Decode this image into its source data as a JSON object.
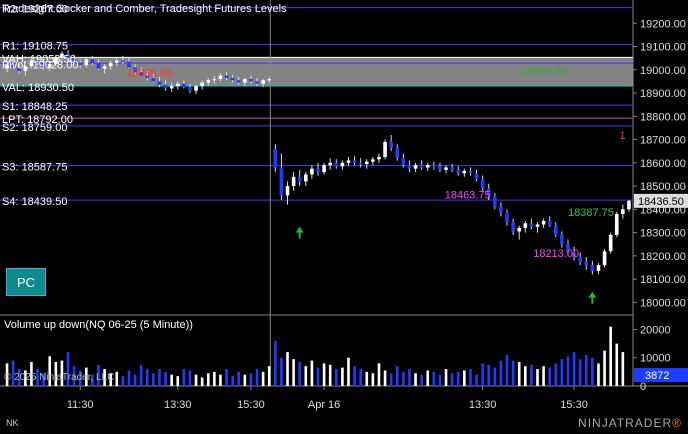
{
  "window": {
    "title": "Tradesight Socker and Comber, Tradesight Futures Levels",
    "pc_button": "PC",
    "corner_label": "NK",
    "brand_text": "NINJATRADER",
    "brand_mark": "®"
  },
  "chart_data": [
    {
      "type": "candlestick",
      "title": "Tradesight Socker and Comber, Tradesight Futures Levels",
      "ylim": [
        17950,
        19300
      ],
      "yticks": [
        18000,
        18100,
        18200,
        18300,
        18400,
        18500,
        18600,
        18700,
        18800,
        18900,
        19000,
        19100,
        19200
      ],
      "ytick_labels": [
        "18000.00",
        "18100.00",
        "18200.00",
        "18300.00",
        "18400.00",
        "18500.00",
        "18600.00",
        "18700.00",
        "18800.00",
        "18900.00",
        "19000.00",
        "19100.00",
        "19200.00"
      ],
      "last_price": "18436.50",
      "levels": [
        {
          "label": "R2: 19267.00",
          "value": 19267.0,
          "color": "#3a3aff"
        },
        {
          "label": "R1: 19108.75",
          "value": 19108.75,
          "color": "#3a3aff"
        },
        {
          "label": "VAH: 19053.50",
          "value": 19053.5,
          "color": "#ffffff"
        },
        {
          "label": "Pivot: 19028.00",
          "value": 19028.0,
          "color": "#3a3aff"
        },
        {
          "label": "VAL: 18930.50",
          "value": 18930.5,
          "color": "#00cccc"
        },
        {
          "label": "S1: 18848.25",
          "value": 18848.25,
          "color": "#3a3aff"
        },
        {
          "label": "LPT: 18792.00",
          "value": 18792.0,
          "color": "#cc44cc"
        },
        {
          "label": "S2: 18759.00",
          "value": 18759.0,
          "color": "#3a3aff"
        },
        {
          "label": "S3: 18587.75",
          "value": 18587.75,
          "color": "#3a3aff"
        },
        {
          "label": "S4: 18439.50",
          "value": 18439.5,
          "color": "#3a3aff"
        }
      ],
      "annotations": [
        {
          "text": "18989.00",
          "x": 0.236,
          "value": 18989,
          "color": "#ff3333"
        },
        {
          "text": "18463.75",
          "x": 0.74,
          "value": 18463.75,
          "color": "#ff44ff"
        },
        {
          "text": "18213.00",
          "x": 0.88,
          "value": 18213,
          "color": "#ff44ff"
        },
        {
          "text": "18387.75",
          "x": 0.935,
          "value": 18387.75,
          "color": "#33cc33"
        },
        {
          "text": "19000.00",
          "x": 0.86,
          "value": 19000,
          "color": "#33aa33"
        },
        {
          "text": "1",
          "x": 0.985,
          "value": 18720,
          "color": "#ff3333"
        }
      ],
      "xtick_labels": [
        "11:30",
        "13:30",
        "15:30",
        "Apr 16",
        "13:30",
        "15:30"
      ],
      "session_break_label": "Apr 16",
      "candles": [
        {
          "o": 19005,
          "h": 19030,
          "l": 18990,
          "c": 19020
        },
        {
          "o": 19020,
          "h": 19040,
          "l": 19005,
          "c": 19010
        },
        {
          "o": 19010,
          "h": 19030,
          "l": 18985,
          "c": 18995
        },
        {
          "o": 18995,
          "h": 19020,
          "l": 18975,
          "c": 19015
        },
        {
          "o": 19015,
          "h": 19050,
          "l": 19005,
          "c": 19040
        },
        {
          "o": 19040,
          "h": 19060,
          "l": 19020,
          "c": 19030
        },
        {
          "o": 19030,
          "h": 19045,
          "l": 19000,
          "c": 19010
        },
        {
          "o": 19010,
          "h": 19035,
          "l": 18995,
          "c": 19025
        },
        {
          "o": 19025,
          "h": 19065,
          "l": 19015,
          "c": 19055
        },
        {
          "o": 19055,
          "h": 19080,
          "l": 19040,
          "c": 19070
        },
        {
          "o": 19070,
          "h": 19085,
          "l": 19040,
          "c": 19050
        },
        {
          "o": 19050,
          "h": 19065,
          "l": 19020,
          "c": 19030
        },
        {
          "o": 19030,
          "h": 19045,
          "l": 19005,
          "c": 19020
        },
        {
          "o": 19020,
          "h": 19050,
          "l": 19010,
          "c": 19045
        },
        {
          "o": 19045,
          "h": 19060,
          "l": 19020,
          "c": 19030
        },
        {
          "o": 19030,
          "h": 19045,
          "l": 19000,
          "c": 19005
        },
        {
          "o": 19005,
          "h": 19025,
          "l": 18985,
          "c": 19015
        },
        {
          "o": 19015,
          "h": 19040,
          "l": 19000,
          "c": 19030
        },
        {
          "o": 19030,
          "h": 19055,
          "l": 19015,
          "c": 19040
        },
        {
          "o": 19040,
          "h": 19060,
          "l": 19025,
          "c": 19035
        },
        {
          "o": 19035,
          "h": 19050,
          "l": 19005,
          "c": 19010
        },
        {
          "o": 19010,
          "h": 19025,
          "l": 18980,
          "c": 18990
        },
        {
          "o": 18990,
          "h": 19010,
          "l": 18970,
          "c": 18975
        },
        {
          "o": 18975,
          "h": 18995,
          "l": 18955,
          "c": 18965
        },
        {
          "o": 18965,
          "h": 18985,
          "l": 18945,
          "c": 18950
        },
        {
          "o": 18950,
          "h": 18970,
          "l": 18925,
          "c": 18935
        },
        {
          "o": 18935,
          "h": 18955,
          "l": 18910,
          "c": 18920
        },
        {
          "o": 18920,
          "h": 18945,
          "l": 18905,
          "c": 18930
        },
        {
          "o": 18930,
          "h": 18950,
          "l": 18915,
          "c": 18940
        },
        {
          "o": 18940,
          "h": 18955,
          "l": 18920,
          "c": 18925
        },
        {
          "o": 18925,
          "h": 18940,
          "l": 18900,
          "c": 18910
        },
        {
          "o": 18910,
          "h": 18935,
          "l": 18895,
          "c": 18930
        },
        {
          "o": 18930,
          "h": 18955,
          "l": 18915,
          "c": 18945
        },
        {
          "o": 18945,
          "h": 18965,
          "l": 18930,
          "c": 18955
        },
        {
          "o": 18955,
          "h": 18975,
          "l": 18940,
          "c": 18960
        },
        {
          "o": 18960,
          "h": 18985,
          "l": 18950,
          "c": 18975
        },
        {
          "o": 18975,
          "h": 18990,
          "l": 18955,
          "c": 18965
        },
        {
          "o": 18965,
          "h": 18980,
          "l": 18945,
          "c": 18955
        },
        {
          "o": 18955,
          "h": 18970,
          "l": 18935,
          "c": 18945
        },
        {
          "o": 18945,
          "h": 18965,
          "l": 18930,
          "c": 18960
        },
        {
          "o": 18960,
          "h": 18975,
          "l": 18940,
          "c": 18950
        },
        {
          "o": 18950,
          "h": 18965,
          "l": 18930,
          "c": 18940
        },
        {
          "o": 18940,
          "h": 18960,
          "l": 18925,
          "c": 18955
        },
        {
          "o": 18955,
          "h": 18970,
          "l": 18945,
          "c": 18960
        },
        {
          "o": 18660,
          "h": 18680,
          "l": 18560,
          "c": 18580
        },
        {
          "o": 18580,
          "h": 18640,
          "l": 18440,
          "c": 18460
        },
        {
          "o": 18460,
          "h": 18520,
          "l": 18420,
          "c": 18500
        },
        {
          "o": 18500,
          "h": 18560,
          "l": 18480,
          "c": 18540
        },
        {
          "o": 18540,
          "h": 18570,
          "l": 18500,
          "c": 18520
        },
        {
          "o": 18520,
          "h": 18560,
          "l": 18500,
          "c": 18550
        },
        {
          "o": 18550,
          "h": 18590,
          "l": 18530,
          "c": 18575
        },
        {
          "o": 18575,
          "h": 18600,
          "l": 18545,
          "c": 18560
        },
        {
          "o": 18560,
          "h": 18600,
          "l": 18550,
          "c": 18590
        },
        {
          "o": 18590,
          "h": 18620,
          "l": 18570,
          "c": 18600
        },
        {
          "o": 18600,
          "h": 18615,
          "l": 18575,
          "c": 18585
        },
        {
          "o": 18585,
          "h": 18610,
          "l": 18570,
          "c": 18600
        },
        {
          "o": 18600,
          "h": 18625,
          "l": 18585,
          "c": 18610
        },
        {
          "o": 18610,
          "h": 18630,
          "l": 18590,
          "c": 18600
        },
        {
          "o": 18600,
          "h": 18620,
          "l": 18580,
          "c": 18595
        },
        {
          "o": 18595,
          "h": 18615,
          "l": 18575,
          "c": 18605
        },
        {
          "o": 18605,
          "h": 18625,
          "l": 18590,
          "c": 18615
        },
        {
          "o": 18615,
          "h": 18640,
          "l": 18600,
          "c": 18625
        },
        {
          "o": 18625,
          "h": 18700,
          "l": 18615,
          "c": 18690
        },
        {
          "o": 18690,
          "h": 18720,
          "l": 18650,
          "c": 18665
        },
        {
          "o": 18665,
          "h": 18680,
          "l": 18610,
          "c": 18620
        },
        {
          "o": 18620,
          "h": 18640,
          "l": 18580,
          "c": 18590
        },
        {
          "o": 18590,
          "h": 18610,
          "l": 18560,
          "c": 18575
        },
        {
          "o": 18575,
          "h": 18600,
          "l": 18560,
          "c": 18590
        },
        {
          "o": 18590,
          "h": 18610,
          "l": 18570,
          "c": 18580
        },
        {
          "o": 18580,
          "h": 18600,
          "l": 18565,
          "c": 18590
        },
        {
          "o": 18590,
          "h": 18605,
          "l": 18570,
          "c": 18585
        },
        {
          "o": 18585,
          "h": 18600,
          "l": 18560,
          "c": 18570
        },
        {
          "o": 18570,
          "h": 18590,
          "l": 18555,
          "c": 18580
        },
        {
          "o": 18580,
          "h": 18595,
          "l": 18560,
          "c": 18570
        },
        {
          "o": 18570,
          "h": 18585,
          "l": 18545,
          "c": 18555
        },
        {
          "o": 18555,
          "h": 18575,
          "l": 18540,
          "c": 18565
        },
        {
          "o": 18565,
          "h": 18580,
          "l": 18545,
          "c": 18555
        },
        {
          "o": 18555,
          "h": 18570,
          "l": 18520,
          "c": 18530
        },
        {
          "o": 18530,
          "h": 18545,
          "l": 18480,
          "c": 18490
        },
        {
          "o": 18490,
          "h": 18510,
          "l": 18440,
          "c": 18455
        },
        {
          "o": 18455,
          "h": 18470,
          "l": 18400,
          "c": 18410
        },
        {
          "o": 18410,
          "h": 18430,
          "l": 18370,
          "c": 18385
        },
        {
          "o": 18385,
          "h": 18400,
          "l": 18330,
          "c": 18345
        },
        {
          "o": 18345,
          "h": 18360,
          "l": 18290,
          "c": 18305
        },
        {
          "o": 18305,
          "h": 18330,
          "l": 18270,
          "c": 18320
        },
        {
          "o": 18320,
          "h": 18350,
          "l": 18300,
          "c": 18340
        },
        {
          "o": 18340,
          "h": 18360,
          "l": 18315,
          "c": 18325
        },
        {
          "o": 18325,
          "h": 18345,
          "l": 18300,
          "c": 18335
        },
        {
          "o": 18335,
          "h": 18360,
          "l": 18320,
          "c": 18350
        },
        {
          "o": 18350,
          "h": 18370,
          "l": 18325,
          "c": 18330
        },
        {
          "o": 18330,
          "h": 18345,
          "l": 18280,
          "c": 18290
        },
        {
          "o": 18290,
          "h": 18305,
          "l": 18235,
          "c": 18250
        },
        {
          "o": 18250,
          "h": 18270,
          "l": 18200,
          "c": 18215
        },
        {
          "o": 18215,
          "h": 18240,
          "l": 18180,
          "c": 18195
        },
        {
          "o": 18195,
          "h": 18215,
          "l": 18160,
          "c": 18175
        },
        {
          "o": 18175,
          "h": 18195,
          "l": 18140,
          "c": 18160
        },
        {
          "o": 18160,
          "h": 18180,
          "l": 18120,
          "c": 18135
        },
        {
          "o": 18135,
          "h": 18170,
          "l": 18120,
          "c": 18160
        },
        {
          "o": 18160,
          "h": 18230,
          "l": 18150,
          "c": 18220
        },
        {
          "o": 18220,
          "h": 18300,
          "l": 18210,
          "c": 18290
        },
        {
          "o": 18290,
          "h": 18390,
          "l": 18280,
          "c": 18380
        },
        {
          "o": 18380,
          "h": 18420,
          "l": 18360,
          "c": 18400
        },
        {
          "o": 18400,
          "h": 18440,
          "l": 18390,
          "c": 18436.5
        }
      ],
      "arrows": [
        {
          "index": 48,
          "value": 18300,
          "color": "#33aa33"
        },
        {
          "index": 96,
          "value": 18020,
          "color": "#33aa33"
        }
      ]
    },
    {
      "type": "bar",
      "title": "Volume up down(NQ 06-25 (5 Minute))",
      "watermark": "© 2025 NinjaTrader, LLC",
      "ylim": [
        0,
        23000
      ],
      "yticks": [
        0,
        10000,
        20000
      ],
      "ytick_labels": [
        "0",
        "10000",
        "20000"
      ],
      "last_value": "3872",
      "values": [
        8000,
        9000,
        6000,
        5500,
        8500,
        6000,
        4500,
        10500,
        8500,
        9000,
        12000,
        7000,
        5500,
        6500,
        4000,
        7500,
        6000,
        4500,
        5000,
        3500,
        5500,
        4000,
        7500,
        6000,
        4500,
        6000,
        5000,
        4000,
        3500,
        6000,
        5500,
        4000,
        3000,
        4500,
        5000,
        4000,
        6000,
        3500,
        5000,
        4000,
        4500,
        6000,
        5000,
        7000,
        16000,
        10000,
        12000,
        9500,
        8500,
        7000,
        9000,
        6500,
        8000,
        7500,
        6000,
        6500,
        10000,
        7000,
        6000,
        5000,
        4500,
        8000,
        5500,
        4500,
        7000,
        5000,
        6000,
        4500,
        4000,
        5500,
        5000,
        4000,
        6000,
        4500,
        5000,
        5500,
        6000,
        4000,
        8000,
        7500,
        6500,
        9000,
        11000,
        9000,
        8500,
        7000,
        7500,
        6000,
        7000,
        6500,
        8000,
        9500,
        10500,
        12000,
        9500,
        11000,
        10000,
        8000,
        12500,
        21000,
        15000,
        12000
      ]
    }
  ]
}
